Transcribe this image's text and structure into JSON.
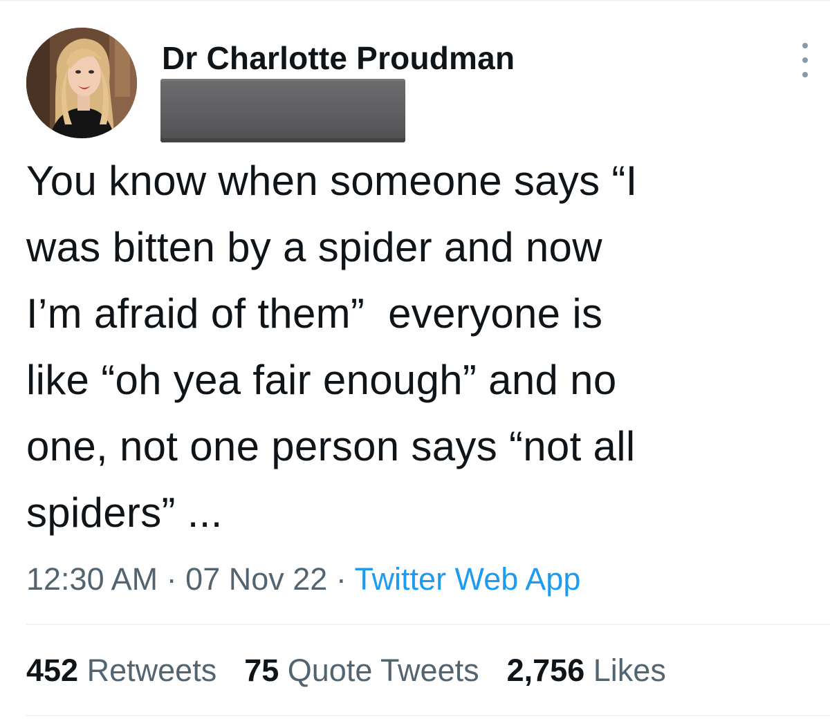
{
  "author": {
    "display_name": "Dr Charlotte Proudman",
    "avatar_icon": "profile-photo",
    "handle_redacted": true
  },
  "tweet": {
    "text_lines": [
      "You know when someone says “I",
      "was bitten by a spider and now",
      "I’m afraid of them”  everyone is",
      "like “oh yea fair enough” and no",
      "one, not one person says “not all",
      "spiders” ..."
    ],
    "time": "12:30 AM",
    "separator": "·",
    "date": "07 Nov 22",
    "source": "Twitter Web App"
  },
  "stats": {
    "retweets_count": "452",
    "retweets_label": "Retweets",
    "quotes_count": "75",
    "quotes_label": "Quote Tweets",
    "likes_count": "2,756",
    "likes_label": "Likes"
  },
  "colors": {
    "text_primary": "#0f1419",
    "text_secondary": "#536471",
    "link": "#1d9bf0",
    "divider": "#eff3f4"
  },
  "icons": {
    "more": "more-vertical-icon"
  }
}
